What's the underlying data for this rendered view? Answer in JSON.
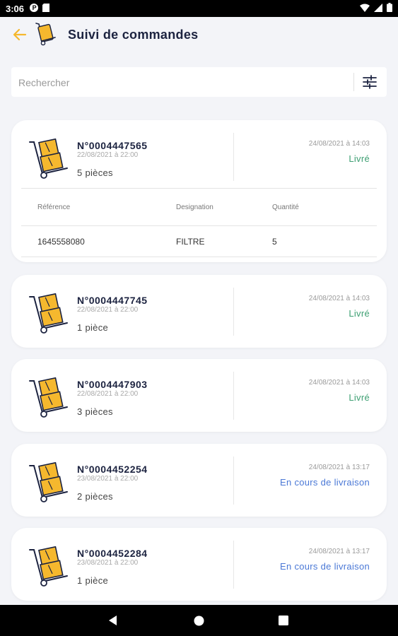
{
  "status_bar": {
    "time": "3:06"
  },
  "header": {
    "title": "Suivi de commandes"
  },
  "search": {
    "placeholder": "Rechercher"
  },
  "table_headers": {
    "reference": "Référence",
    "designation": "Designation",
    "quantity": "Quantité"
  },
  "orders": [
    {
      "number": "N°0004447565",
      "date": "22/08/2021 à 22:00",
      "pieces": "5 pièces",
      "status_date": "24/08/2021 à 14:03",
      "status": "Livré",
      "items": [
        {
          "reference": "1645558080",
          "designation": "FILTRE",
          "quantity": "5"
        }
      ]
    },
    {
      "number": "N°0004447745",
      "date": "22/08/2021 à 22:00",
      "pieces": "1 pièce",
      "status_date": "24/08/2021 à 14:03",
      "status": "Livré"
    },
    {
      "number": "N°0004447903",
      "date": "22/08/2021 à 22:00",
      "pieces": "3 pièces",
      "status_date": "24/08/2021 à 14:03",
      "status": "Livré"
    },
    {
      "number": "N°0004452254",
      "date": "23/08/2021 à 22:00",
      "pieces": "2 pièces",
      "status_date": "24/08/2021 à 13:17",
      "status": "En cours de livraison"
    },
    {
      "number": "N°0004452284",
      "date": "23/08/2021 à 22:00",
      "pieces": "1 pièce",
      "status_date": "24/08/2021 à 13:17",
      "status": "En cours de livraison"
    }
  ],
  "colors": {
    "accent": "#f5b82e",
    "delivered": "#3d9f72",
    "in_transit": "#4a78d6",
    "title": "#1c2340"
  },
  "icons": [
    "back-arrow-icon",
    "app-logo-icon",
    "filter-icon",
    "hand-truck-icon",
    "nav-back-icon",
    "nav-home-icon",
    "nav-recents-icon"
  ]
}
